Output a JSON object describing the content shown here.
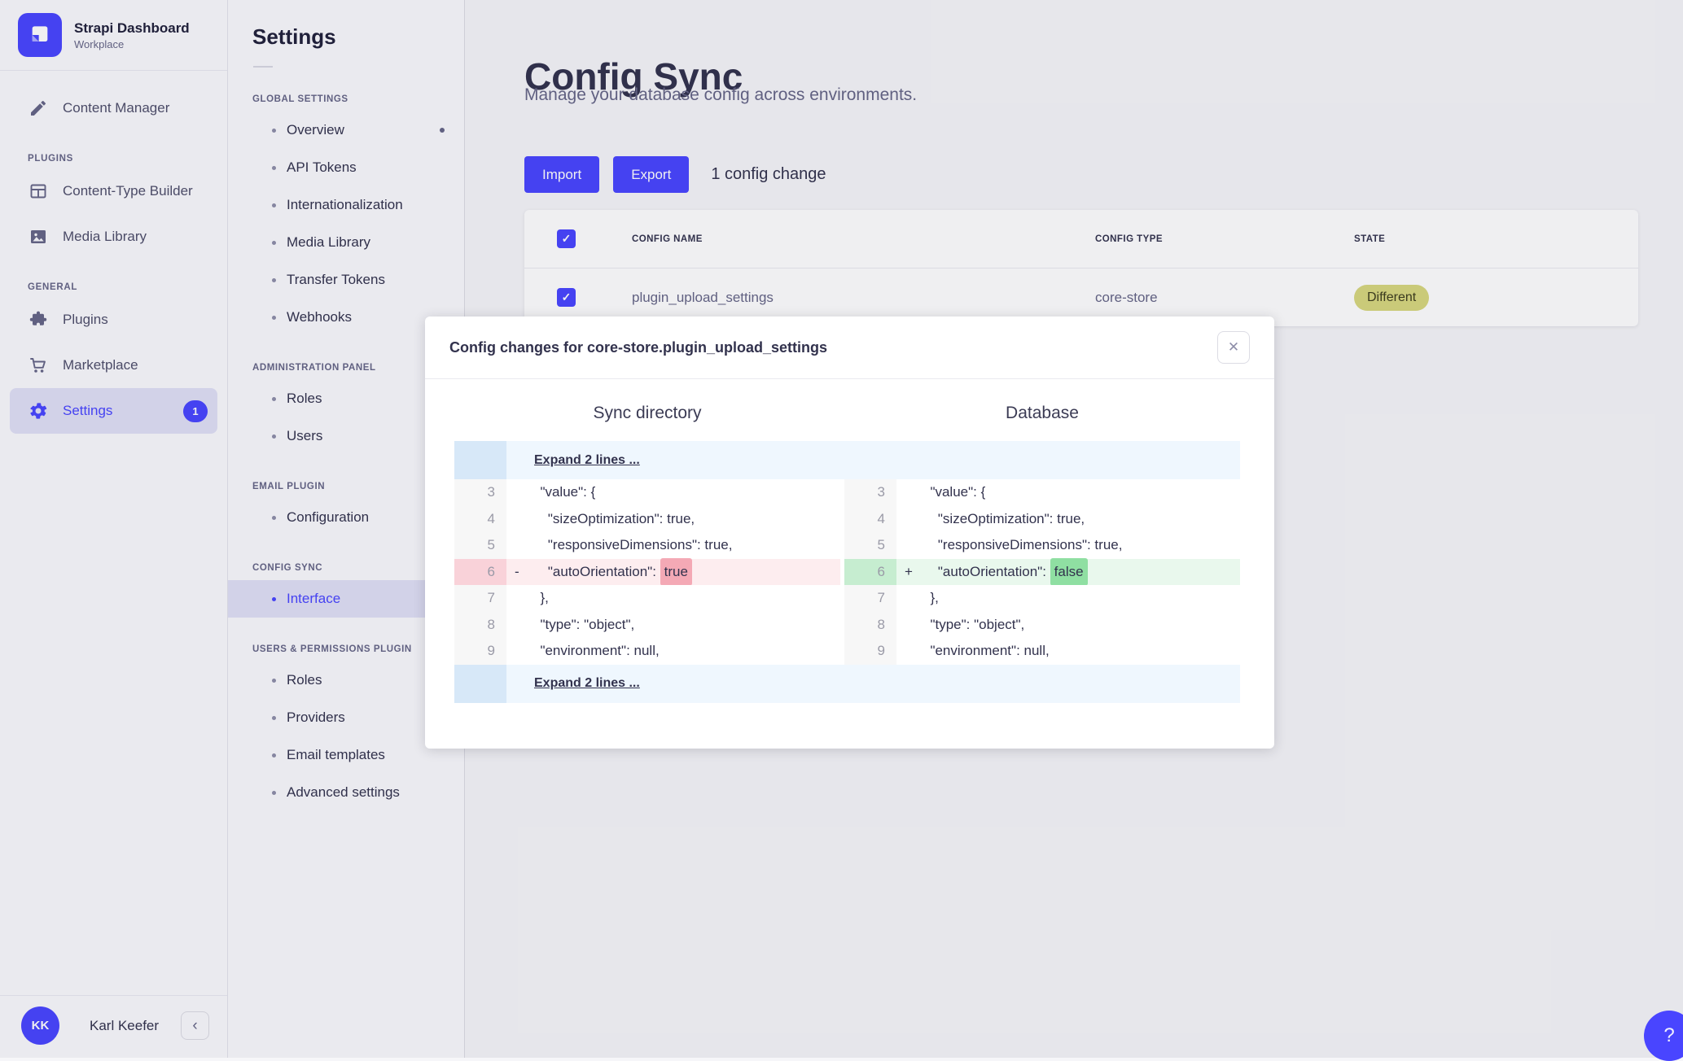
{
  "colors": {
    "accent": "#4945ff",
    "selected-bg": "#e0e0f6",
    "badge-bg": "#d8d87e",
    "badge-text": "#3d3d1d",
    "del-bg": "#fdedef",
    "del-gutter": "#f9d2d9",
    "del-token": "#f4a9b5",
    "add-bg": "#e9f8ed",
    "add-gutter": "#c6edd0",
    "add-token": "#8fdfa2",
    "info-bg": "#eff7fe",
    "info-gutter": "#d7e8f8"
  },
  "icons": {
    "close": "✕",
    "collapse": "‹",
    "help": "?",
    "check": "✓"
  },
  "brand": {
    "name": "Strapi Dashboard",
    "workspace": "Workplace"
  },
  "main_nav": {
    "content_manager": "Content Manager",
    "plugins_section": "PLUGINS",
    "content_type_builder": "Content-Type Builder",
    "media_library": "Media Library",
    "general_section": "GENERAL",
    "plugins": "Plugins",
    "marketplace": "Marketplace",
    "settings": "Settings",
    "settings_badge": "1",
    "user_initials": "KK",
    "user_name": "Karl Keefer"
  },
  "settings_nav": {
    "title": "Settings",
    "sections": [
      {
        "label": "GLOBAL SETTINGS",
        "items": [
          "Overview",
          "API Tokens",
          "Internationalization",
          "Media Library",
          "Transfer Tokens",
          "Webhooks"
        ]
      },
      {
        "label": "ADMINISTRATION PANEL",
        "items": [
          "Roles",
          "Users"
        ]
      },
      {
        "label": "EMAIL PLUGIN",
        "items": [
          "Configuration"
        ]
      },
      {
        "label": "CONFIG SYNC",
        "items": [
          "Interface"
        ]
      },
      {
        "label": "USERS & PERMISSIONS PLUGIN",
        "items": [
          "Roles",
          "Providers",
          "Email templates",
          "Advanced settings"
        ]
      }
    ]
  },
  "content": {
    "title": "Config Sync",
    "subtitle": "Manage your database config across environments.",
    "import": "Import",
    "export": "Export",
    "changes": "1 config change",
    "table": {
      "col_name": "CONFIG NAME",
      "col_type": "CONFIG TYPE",
      "col_state": "STATE",
      "row": {
        "name": "plugin_upload_settings",
        "type": "core-store",
        "state": "Different"
      }
    }
  },
  "modal": {
    "title": "Config changes for core-store.plugin_upload_settings",
    "left_header": "Sync directory",
    "right_header": "Database",
    "expand_top": "Expand 2 lines ...",
    "expand_bottom": "Expand 2 lines ...",
    "diff": {
      "left": [
        {
          "num": "3",
          "text": "  \"value\": {"
        },
        {
          "num": "4",
          "text": "    \"sizeOptimization\": true,"
        },
        {
          "num": "5",
          "text": "    \"responsiveDimensions\": true,"
        },
        {
          "num": "6",
          "sign": "-",
          "text": "    \"autoOrientation\": ",
          "token": "true"
        },
        {
          "num": "7",
          "text": "  },"
        },
        {
          "num": "8",
          "text": "  \"type\": \"object\","
        },
        {
          "num": "9",
          "text": "  \"environment\": null,"
        }
      ],
      "right": [
        {
          "num": "3",
          "text": "  \"value\": {"
        },
        {
          "num": "4",
          "text": "    \"sizeOptimization\": true,"
        },
        {
          "num": "5",
          "text": "    \"responsiveDimensions\": true,"
        },
        {
          "num": "6",
          "sign": "+",
          "text": "    \"autoOrientation\": ",
          "token": "false"
        },
        {
          "num": "7",
          "text": "  },"
        },
        {
          "num": "8",
          "text": "  \"type\": \"object\","
        },
        {
          "num": "9",
          "text": "  \"environment\": null,"
        }
      ]
    }
  }
}
